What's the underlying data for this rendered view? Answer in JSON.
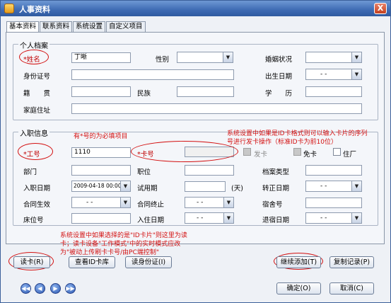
{
  "window": {
    "title": "人事资料",
    "close_glyph": "X"
  },
  "tabs": [
    "基本资料",
    "联系资料",
    "系统设置",
    "自定义项目"
  ],
  "personal": {
    "group_label": "个人档案",
    "name_label": "*姓名",
    "name_value": "丁晰",
    "gender_label": "性别",
    "gender_value": "",
    "marital_label": "婚姻状况",
    "marital_value": "",
    "idcard_label": "身份证号",
    "idcard_value": "",
    "birth_label": "出生日期",
    "birth_value": "-  -",
    "native_label": "籍　　贯",
    "native_value": "",
    "ethnic_label": "民族",
    "ethnic_value": "",
    "edu_label": "学　　历",
    "edu_value": "",
    "address_label": "家庭住址",
    "address_value": ""
  },
  "employment": {
    "group_label": "入职信息",
    "required_note": "有*号的为必填项目",
    "workno_label": "*工号",
    "workno_value": "1110",
    "cardno_label": "*卡号",
    "cardno_value": "",
    "issue_label": "发卡",
    "free_label": "免卡",
    "resident_label": "住厂",
    "dept_label": "部门",
    "dept_value": "",
    "position_label": "职位",
    "position_value": "",
    "archive_label": "档案类型",
    "archive_value": "",
    "hire_label": "入职日期",
    "hire_value": "2009-04-18 00:00:00",
    "trial_label": "试用期",
    "trial_value": "",
    "trial_unit": "(天)",
    "regular_label": "转正日期",
    "regular_value": "-  -",
    "contract_start_label": "合同生效",
    "contract_start_value": "-  -",
    "contract_end_label": "合同终止",
    "contract_end_value": "-  -",
    "dorm_label": "宿舍号",
    "dorm_value": "",
    "bed_label": "床位号",
    "bed_value": "",
    "checkin_label": "入住日期",
    "checkin_value": "-  -",
    "checkout_label": "退宿日期",
    "checkout_value": "-  -"
  },
  "annotations": {
    "card_note": "系统设置中如果是ID卡格式则可以输入卡片的序列号进行发卡操作（标准ID卡为前10位）",
    "reader_note": "系统设置中如果选择的是\"ID卡片\"则这里为读卡；读卡设备\"工作模式\"中的实时模式应改为\"被动上传刷卡卡号/由PC端控制\""
  },
  "buttons": {
    "read_card": "读卡(R)",
    "view_id_db": "查看ID卡库",
    "read_id": "读身份证(I)",
    "continue_add": "继续添加(T)",
    "copy_record": "复制记录(P)",
    "ok": "确定(O)",
    "cancel": "取消(C)"
  },
  "nav": {
    "first": "◀◀",
    "prev": "◀",
    "next": "▶",
    "last": "▶▶"
  }
}
